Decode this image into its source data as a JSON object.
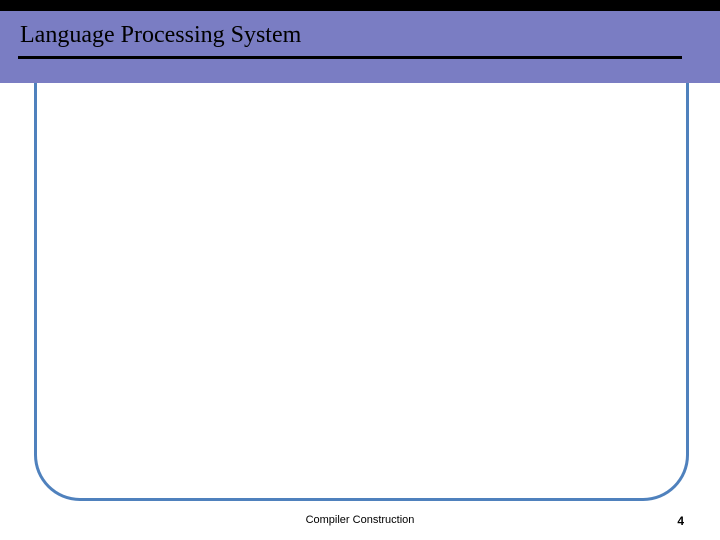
{
  "header": {
    "title": "Language Processing System"
  },
  "footer": {
    "text": "Compiler Construction",
    "page": "4"
  }
}
